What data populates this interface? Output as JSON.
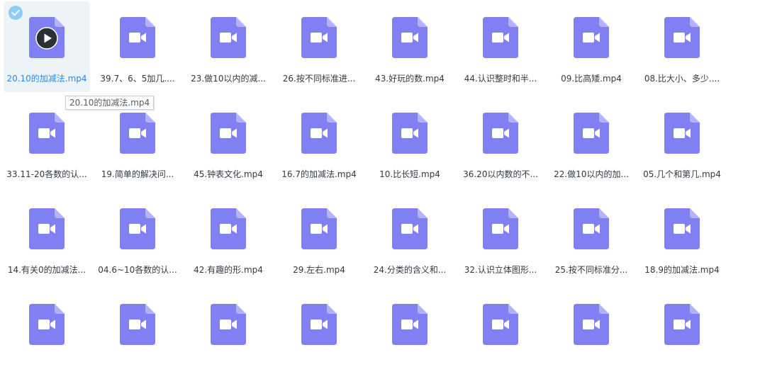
{
  "colors": {
    "icon_body": "#8080f2",
    "icon_fold": "#b3b3f8",
    "selected_bg": "#eef3f8",
    "selected_text": "#2b8ae2",
    "check_badge": "#8ecdf7"
  },
  "icons": {
    "file": "video-file-icon",
    "check": "check-circle-icon",
    "play": "play-icon"
  },
  "files": [
    {
      "name": "20.10的加减法.mp4",
      "selected": true
    },
    {
      "name": "39.7、6、5加几...."
    },
    {
      "name": "23.做10以内的减..."
    },
    {
      "name": "26.按不同标准进..."
    },
    {
      "name": "43.好玩的数.mp4"
    },
    {
      "name": "44.认识整时和半..."
    },
    {
      "name": "09.比高矮.mp4"
    },
    {
      "name": "08.比大小、多少...."
    },
    {
      "name": "33.11-20各数的认..."
    },
    {
      "name": "19.简单的解决问..."
    },
    {
      "name": "45.钟表文化.mp4"
    },
    {
      "name": "16.7的加减法.mp4"
    },
    {
      "name": "10.比长短.mp4"
    },
    {
      "name": "36.20以内数的不..."
    },
    {
      "name": "22.做10以内的加..."
    },
    {
      "name": "05.几个和第几.mp4"
    },
    {
      "name": "14.有关0的加减法..."
    },
    {
      "name": "04.6~10各数的认..."
    },
    {
      "name": "42.有趣的形.mp4"
    },
    {
      "name": "29.左右.mp4"
    },
    {
      "name": "24.分类的含义和..."
    },
    {
      "name": "32.认识立体图形..."
    },
    {
      "name": "25.按不同标准分..."
    },
    {
      "name": "18.9的加减法.mp4"
    },
    {
      "name": ""
    },
    {
      "name": ""
    },
    {
      "name": ""
    },
    {
      "name": ""
    },
    {
      "name": ""
    },
    {
      "name": ""
    },
    {
      "name": ""
    },
    {
      "name": ""
    }
  ],
  "tooltip": {
    "text": "20.10的加减法.mp4"
  }
}
